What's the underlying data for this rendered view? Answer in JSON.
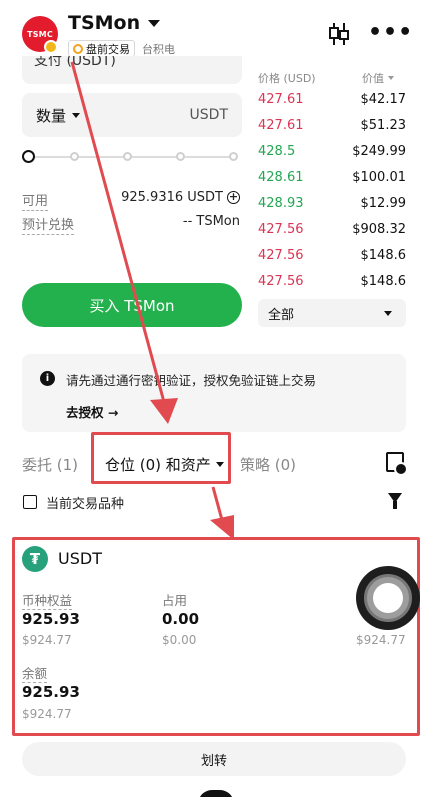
{
  "header": {
    "logo_text": "TSMC",
    "title": "TSMon",
    "premarket_label": "盘前交易",
    "exchange_label": "台积电"
  },
  "trade": {
    "pay_label": "支付 (USDT)",
    "quantity_label": "数量",
    "quantity_unit": "USDT",
    "slider_percent": 0,
    "available_label": "可用",
    "available_value": "925.9316 USDT",
    "estimate_label": "预计兑换",
    "estimate_value": "-- TSMon",
    "buy_button": "买入 TSMon"
  },
  "orderbook": {
    "price_header": "价格 (USD)",
    "value_header": "价值",
    "rows": [
      {
        "price": "427.61",
        "value": "$42.17",
        "side": "sell"
      },
      {
        "price": "427.61",
        "value": "$51.23",
        "side": "sell"
      },
      {
        "price": "428.5",
        "value": "$249.99",
        "side": "buy"
      },
      {
        "price": "428.61",
        "value": "$100.01",
        "side": "buy"
      },
      {
        "price": "428.93",
        "value": "$12.99",
        "side": "buy"
      },
      {
        "price": "427.56",
        "value": "$908.32",
        "side": "sell"
      },
      {
        "price": "427.56",
        "value": "$148.6",
        "side": "sell"
      },
      {
        "price": "427.56",
        "value": "$148.6",
        "side": "sell"
      }
    ],
    "filter_value": "全部"
  },
  "notice": {
    "text": "请先通过通行密钥验证，授权免验证链上交易",
    "link": "去授权 →"
  },
  "tabs": {
    "orders": "委托 (1)",
    "positions": "仓位 (0) 和资产",
    "strategy": "策略 (0)"
  },
  "filter": {
    "current_only_label": "当前交易品种"
  },
  "asset": {
    "name": "USDT",
    "equity_label": "币种权益",
    "equity_value": "925.93",
    "equity_usd": "$924.77",
    "occupied_label": "占用",
    "occupied_value": "0.00",
    "occupied_usd": "$0.00",
    "right_usd": "$924.77",
    "balance_label": "余额",
    "balance_value": "925.93",
    "balance_usd": "$924.77"
  },
  "transfer_button": "划转",
  "colors": {
    "buy_green": "#23b14d",
    "sell_red": "#d93655",
    "annotation_red": "#e14b50",
    "usdt_teal": "#26a17b"
  }
}
